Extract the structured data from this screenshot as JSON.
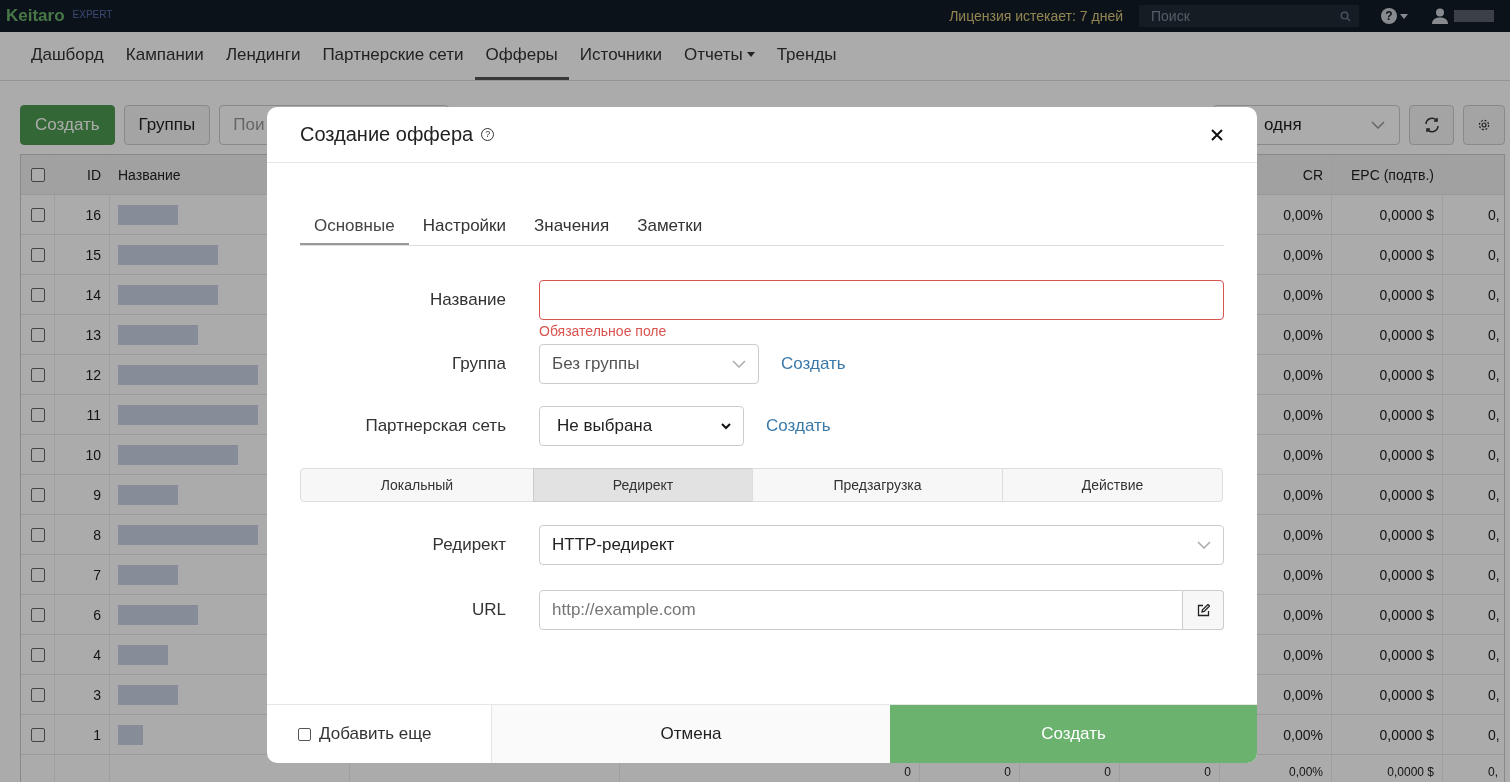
{
  "topbar": {
    "logo": "Keitaro",
    "edition": "EXPERT",
    "license": "Лицензия истекает: 7 дней",
    "help": "?",
    "search": {
      "placeholder": "Поиск"
    }
  },
  "nav": [
    {
      "label": "Дашборд",
      "selected": false,
      "dropdown": false
    },
    {
      "label": "Кампании",
      "selected": false,
      "dropdown": false
    },
    {
      "label": "Лендинги",
      "selected": false,
      "dropdown": false
    },
    {
      "label": "Партнерские сети",
      "selected": false,
      "dropdown": false
    },
    {
      "label": "Офферы",
      "selected": true,
      "dropdown": false
    },
    {
      "label": "Источники",
      "selected": false,
      "dropdown": false
    },
    {
      "label": "Отчеты",
      "selected": false,
      "dropdown": true
    },
    {
      "label": "Тренды",
      "selected": false,
      "dropdown": false
    }
  ],
  "toolbar": {
    "create": "Создать",
    "groups": "Группы",
    "search": {
      "placeholder": "Пои"
    },
    "period": "одня"
  },
  "table": {
    "all_checked": false,
    "columns": {
      "id": "ID",
      "name": "Название",
      "cr": "CR",
      "epc": "EPC (подтв.)"
    },
    "rows": [
      {
        "id": "16",
        "checked": false,
        "cr": "0,00%",
        "epc": "0,0000 $",
        "column_8": "0,"
      },
      {
        "id": "15",
        "checked": false,
        "cr": "0,00%",
        "epc": "0,0000 $",
        "column_8": "0,"
      },
      {
        "id": "14",
        "checked": false,
        "cr": "0,00%",
        "epc": "0,0000 $",
        "column_8": "0,"
      },
      {
        "id": "13",
        "checked": false,
        "cr": "0,00%",
        "epc": "0,0000 $",
        "column_8": "0,"
      },
      {
        "id": "12",
        "checked": false,
        "cr": "0,00%",
        "epc": "0,0000 $",
        "column_8": "0,"
      },
      {
        "id": "11",
        "checked": false,
        "cr": "0,00%",
        "epc": "0,0000 $",
        "column_8": "0,"
      },
      {
        "id": "10",
        "checked": false,
        "cr": "0,00%",
        "epc": "0,0000 $",
        "column_8": "0,"
      },
      {
        "id": "9",
        "checked": false,
        "cr": "0,00%",
        "epc": "0,0000 $",
        "column_8": "0,"
      },
      {
        "id": "8",
        "checked": false,
        "cr": "0,00%",
        "epc": "0,0000 $",
        "column_8": "0,"
      },
      {
        "id": "7",
        "checked": false,
        "cr": "0,00%",
        "epc": "0,0000 $",
        "column_8": "0,"
      },
      {
        "id": "6",
        "checked": false,
        "cr": "0,00%",
        "epc": "0,0000 $",
        "column_8": "0,"
      },
      {
        "id": "4",
        "checked": false,
        "cr": "0,00%",
        "epc": "0,0000 $",
        "column_8": "0,"
      },
      {
        "id": "3",
        "checked": false,
        "cr": "0,00%",
        "epc": "0,0000 $",
        "column_8": "0,"
      },
      {
        "id": "1",
        "checked": false,
        "cr": "0,00%",
        "epc": "0,0000 $",
        "column_8": "0,"
      }
    ],
    "totals": {
      "column_4": "0",
      "column_5": "0",
      "column_6": "0",
      "column_7": "0",
      "cr": "0,00%",
      "epc": "0,0000 $",
      "column_8": "0,"
    }
  },
  "modal": {
    "title": "Создание оффера",
    "help": "?",
    "tabs": [
      {
        "label": "Основные",
        "selected": true
      },
      {
        "label": "Настройки",
        "selected": false
      },
      {
        "label": "Значения",
        "selected": false
      },
      {
        "label": "Заметки",
        "selected": false
      }
    ],
    "name": {
      "label": "Название",
      "invalid": true,
      "error": "Обязательное поле"
    },
    "group": {
      "label": "Группа",
      "value": "Без группы",
      "create_link": "Создать"
    },
    "network": {
      "label": "Партнерская сеть",
      "value": "Не выбрана",
      "create_link": "Создать"
    },
    "types": [
      {
        "label": "Локальный",
        "selected": false
      },
      {
        "label": "Редирект",
        "selected": true
      },
      {
        "label": "Предзагрузка",
        "selected": false
      },
      {
        "label": "Действие",
        "selected": false
      }
    ],
    "redirect": {
      "label": "Редирект",
      "value": "HTTP-редирект"
    },
    "url": {
      "label": "URL",
      "placeholder": "http://example.com"
    },
    "add_more": {
      "label": "Добавить еще",
      "checked": false
    },
    "cancel": "Отмена",
    "submit": "Создать"
  }
}
